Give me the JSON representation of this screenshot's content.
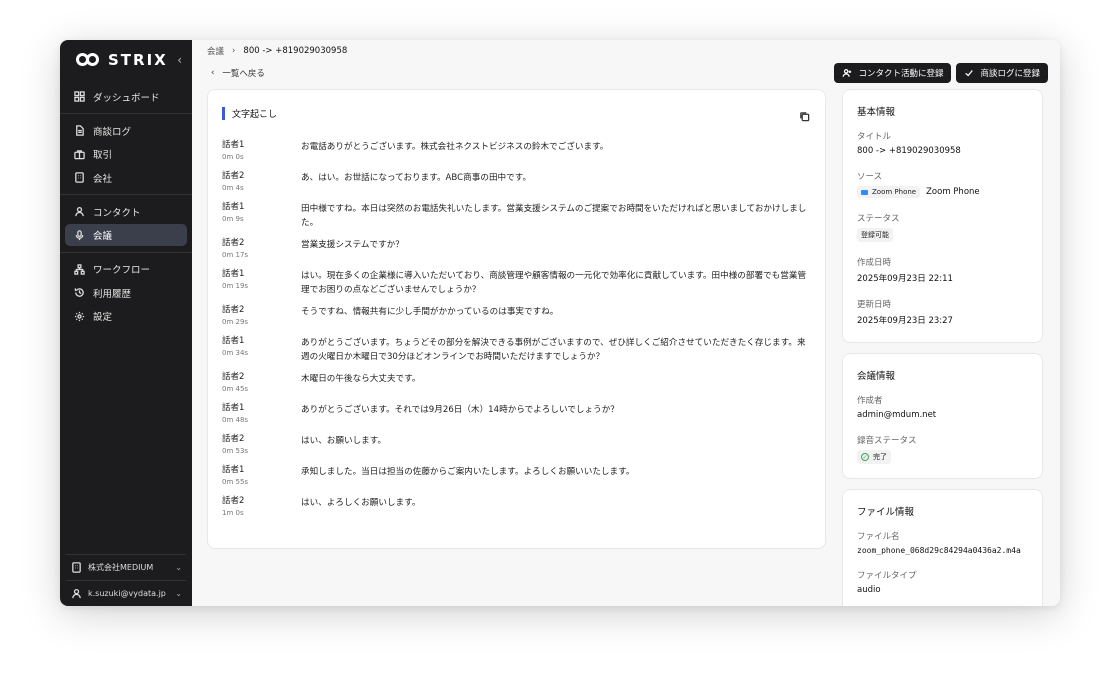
{
  "sidebar": {
    "logo_text": "STRIX",
    "collapse_glyph": "‹",
    "groups": [
      [
        {
          "label": "ダッシュボード",
          "icon": "dashboard-icon"
        }
      ],
      [
        {
          "label": "商談ログ",
          "icon": "document-icon"
        },
        {
          "label": "取引",
          "icon": "briefcase-icon"
        },
        {
          "label": "会社",
          "icon": "building-icon"
        }
      ],
      [
        {
          "label": "コンタクト",
          "icon": "user-icon"
        },
        {
          "label": "会議",
          "icon": "microphone-icon",
          "active": true
        }
      ],
      [
        {
          "label": "ワークフロー",
          "icon": "workflow-icon"
        },
        {
          "label": "利用履歴",
          "icon": "history-icon"
        },
        {
          "label": "設定",
          "icon": "gear-icon"
        }
      ]
    ],
    "footer": {
      "company": "株式会社MEDIUM",
      "user": "k.suzuki@vydata.jp"
    }
  },
  "breadcrumb": {
    "parent": "会議",
    "separator": "›",
    "current": "800 -> +819029030958"
  },
  "back_link": "一覧へ戻る",
  "actions": {
    "contact_activity": "コンタクト活動に登録",
    "deal_log": "商談ログに登録"
  },
  "transcript": {
    "title": "文字起こし",
    "lines": [
      {
        "speaker": "話者1",
        "time": "0m 0s",
        "text": "お電話ありがとうございます。株式会社ネクストビジネスの鈴木でございます。"
      },
      {
        "speaker": "話者2",
        "time": "0m 4s",
        "text": "あ、はい。お世話になっております。ABC商事の田中です。"
      },
      {
        "speaker": "話者1",
        "time": "0m 9s",
        "text": "田中様ですね。本日は突然のお電話失礼いたします。営業支援システムのご提案でお時間をいただければと思いましておかけしました。"
      },
      {
        "speaker": "話者2",
        "time": "0m 17s",
        "text": "営業支援システムですか？"
      },
      {
        "speaker": "話者1",
        "time": "0m 19s",
        "text": "はい。現在多くの企業様に導入いただいており、商談管理や顧客情報の一元化で効率化に貢献しています。田中様の部署でも営業管理でお困りの点などございませんでしょうか？"
      },
      {
        "speaker": "話者2",
        "time": "0m 29s",
        "text": "そうですね、情報共有に少し手間がかかっているのは事実ですね。"
      },
      {
        "speaker": "話者1",
        "time": "0m 34s",
        "text": "ありがとうございます。ちょうどその部分を解決できる事例がございますので、ぜひ詳しくご紹介させていただきたく存じます。来週の火曜日か木曜日で30分ほどオンラインでお時間いただけますでしょうか？"
      },
      {
        "speaker": "話者2",
        "time": "0m 45s",
        "text": "木曜日の午後なら大丈夫です。"
      },
      {
        "speaker": "話者1",
        "time": "0m 48s",
        "text": "ありがとうございます。それでは9月26日（木）14時からでよろしいでしょうか？"
      },
      {
        "speaker": "話者2",
        "time": "0m 53s",
        "text": "はい、お願いします。"
      },
      {
        "speaker": "話者1",
        "time": "0m 55s",
        "text": "承知しました。当日は担当の佐藤からご案内いたします。よろしくお願いいたします。"
      },
      {
        "speaker": "話者2",
        "time": "1m 0s",
        "text": "はい、よろしくお願いします。"
      }
    ]
  },
  "basic_info": {
    "heading": "基本情報",
    "title_label": "タイトル",
    "title_value": "800 -> +819029030958",
    "source_label": "ソース",
    "source_badge": "Zoom Phone",
    "source_value": "Zoom Phone",
    "status_label": "ステータス",
    "status_value": "登録可能",
    "created_label": "作成日時",
    "created_value": "2025年09月23日 22:11",
    "updated_label": "更新日時",
    "updated_value": "2025年09月23日 23:27"
  },
  "meeting_info": {
    "heading": "会議情報",
    "creator_label": "作成者",
    "creator_value": "admin@mdum.net",
    "recording_label": "録音ステータス",
    "recording_value": "完了"
  },
  "file_info": {
    "heading": "ファイル情報",
    "name_label": "ファイル名",
    "name_value": "zoom_phone_068d29c84294a0436a2.m4a",
    "type_label": "ファイルタイプ",
    "type_value": "audio"
  },
  "colors": {
    "sidebar_bg": "#1c1c1e",
    "active_nav": "#3a3f4b",
    "accent": "#3b5bdb",
    "success": "#3aa655"
  }
}
